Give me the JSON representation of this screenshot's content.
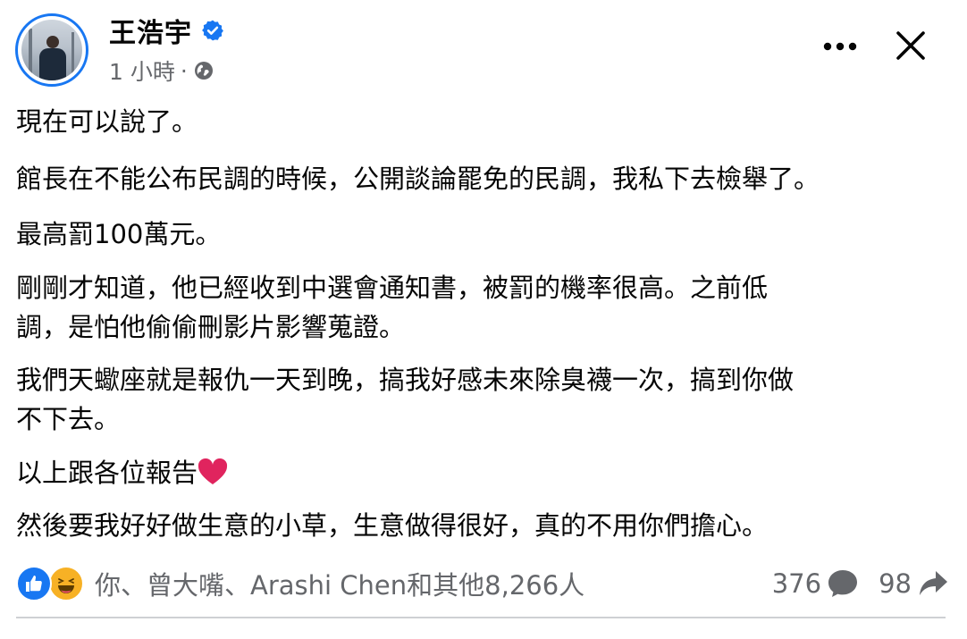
{
  "post": {
    "author": "王浩宇",
    "time": "1 小時",
    "meta_separator": "·",
    "paragraphs": [
      "現在可以說了。",
      "館長在不能公布民調的時候，公開談論罷免的民調，我私下去檢舉了。",
      "最高罰100萬元。",
      "￼剛剛才知道，他已經收到中選會通知書，被罰的機率很高。之前低\n調，是怕他偷偷刪影片影響蒐證。",
      "￼我們天蠍座就是報仇一天到晚，搞我好感未來除臭襪一次，搞到你做\n不下去。",
      "以上跟各位報告",
      "然後要我好好做生意的小草，生意做得很好，真的不用你們擔￼心。"
    ],
    "reactions": {
      "icons": [
        "like-icon",
        "haha-icon"
      ],
      "summary": "你、曾大嘴、Arashi Chen和其他8,266人"
    },
    "comments_count": "376",
    "shares_count": "98"
  },
  "colors": {
    "verified_blue": "#1877f2",
    "secondary_text": "#65676b",
    "heart_red": "#e0245e"
  }
}
